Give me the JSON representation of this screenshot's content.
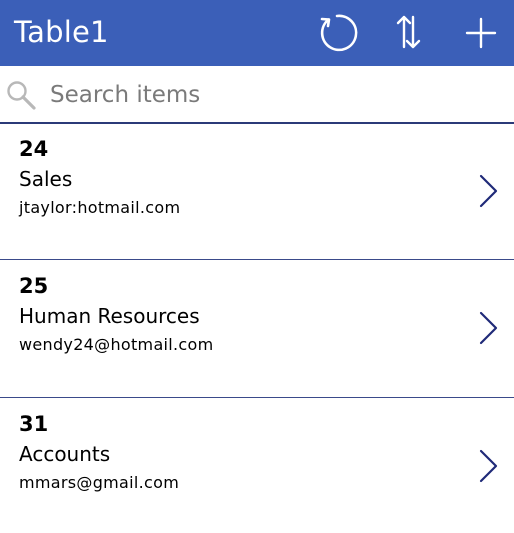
{
  "header": {
    "title": "Table1",
    "icons": [
      "refresh-icon",
      "sort-icon",
      "add-icon"
    ]
  },
  "search": {
    "value": "",
    "placeholder": "Search items",
    "icon": "search-icon"
  },
  "items": [
    {
      "id": "24",
      "department": "Sales",
      "email": "jtaylor:hotmail.com"
    },
    {
      "id": "25",
      "department": "Human Resources",
      "email": "wendy24@hotmail.com"
    },
    {
      "id": "31",
      "department": "Accounts",
      "email": "mmars@gmail.com"
    }
  ],
  "colors": {
    "header_bg": "#3B5FB8",
    "header_text": "#FFFFFF",
    "divider": "#2B3A78",
    "chevron": "#1F2A78"
  }
}
